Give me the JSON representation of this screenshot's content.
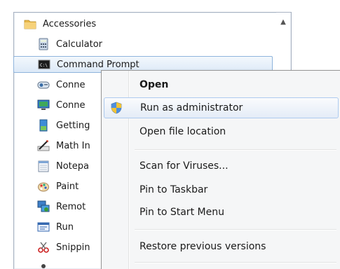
{
  "start_menu": {
    "folder": {
      "label": "Accessories",
      "icon": "folder-icon"
    },
    "items": [
      {
        "label": "Calculator",
        "icon": "calculator-icon"
      },
      {
        "label": "Command Prompt",
        "icon": "command-prompt-icon"
      },
      {
        "label": "Conne",
        "icon": "connect-projector-icon"
      },
      {
        "label": "Conne",
        "icon": "remote-desktop-monitor-icon"
      },
      {
        "label": "Getting",
        "icon": "getting-started-icon"
      },
      {
        "label": "Math In",
        "icon": "math-input-icon"
      },
      {
        "label": "Notepa",
        "icon": "notepad-icon"
      },
      {
        "label": "Paint",
        "icon": "paint-icon"
      },
      {
        "label": "Remot",
        "icon": "remote-desktop-icon"
      },
      {
        "label": "Run",
        "icon": "run-icon"
      },
      {
        "label": "Snippin",
        "icon": "snipping-tool-icon"
      }
    ]
  },
  "context_menu": {
    "items": [
      {
        "label": "Open"
      },
      {
        "label": "Run as administrator",
        "icon": "uac-shield-icon"
      },
      {
        "label": "Open file location"
      },
      {
        "label": "Scan for Viruses..."
      },
      {
        "label": "Pin to Taskbar"
      },
      {
        "label": "Pin to Start Menu"
      },
      {
        "label": "Restore previous versions"
      }
    ]
  },
  "colors": {
    "selection_border": "#8fb4dc",
    "menu_hover_border": "#aecbef",
    "menu_background": "#f5f6f7"
  }
}
